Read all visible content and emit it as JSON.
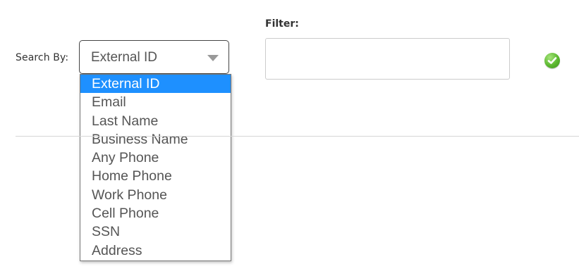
{
  "search": {
    "label": "Search By:",
    "selected_value": "External ID",
    "options": [
      "External ID",
      "Email",
      "Last Name",
      "Business Name",
      "Any Phone",
      "Home Phone",
      "Work Phone",
      "Cell Phone",
      "SSN",
      "Address"
    ],
    "highlighted_option": "External ID"
  },
  "filter": {
    "label": "Filter:",
    "value": "",
    "placeholder": ""
  },
  "go_button": {
    "icon": "checkmark-icon",
    "color": "#5bb82f"
  },
  "colors": {
    "highlight": "#1e90ff",
    "text": "#555555"
  }
}
